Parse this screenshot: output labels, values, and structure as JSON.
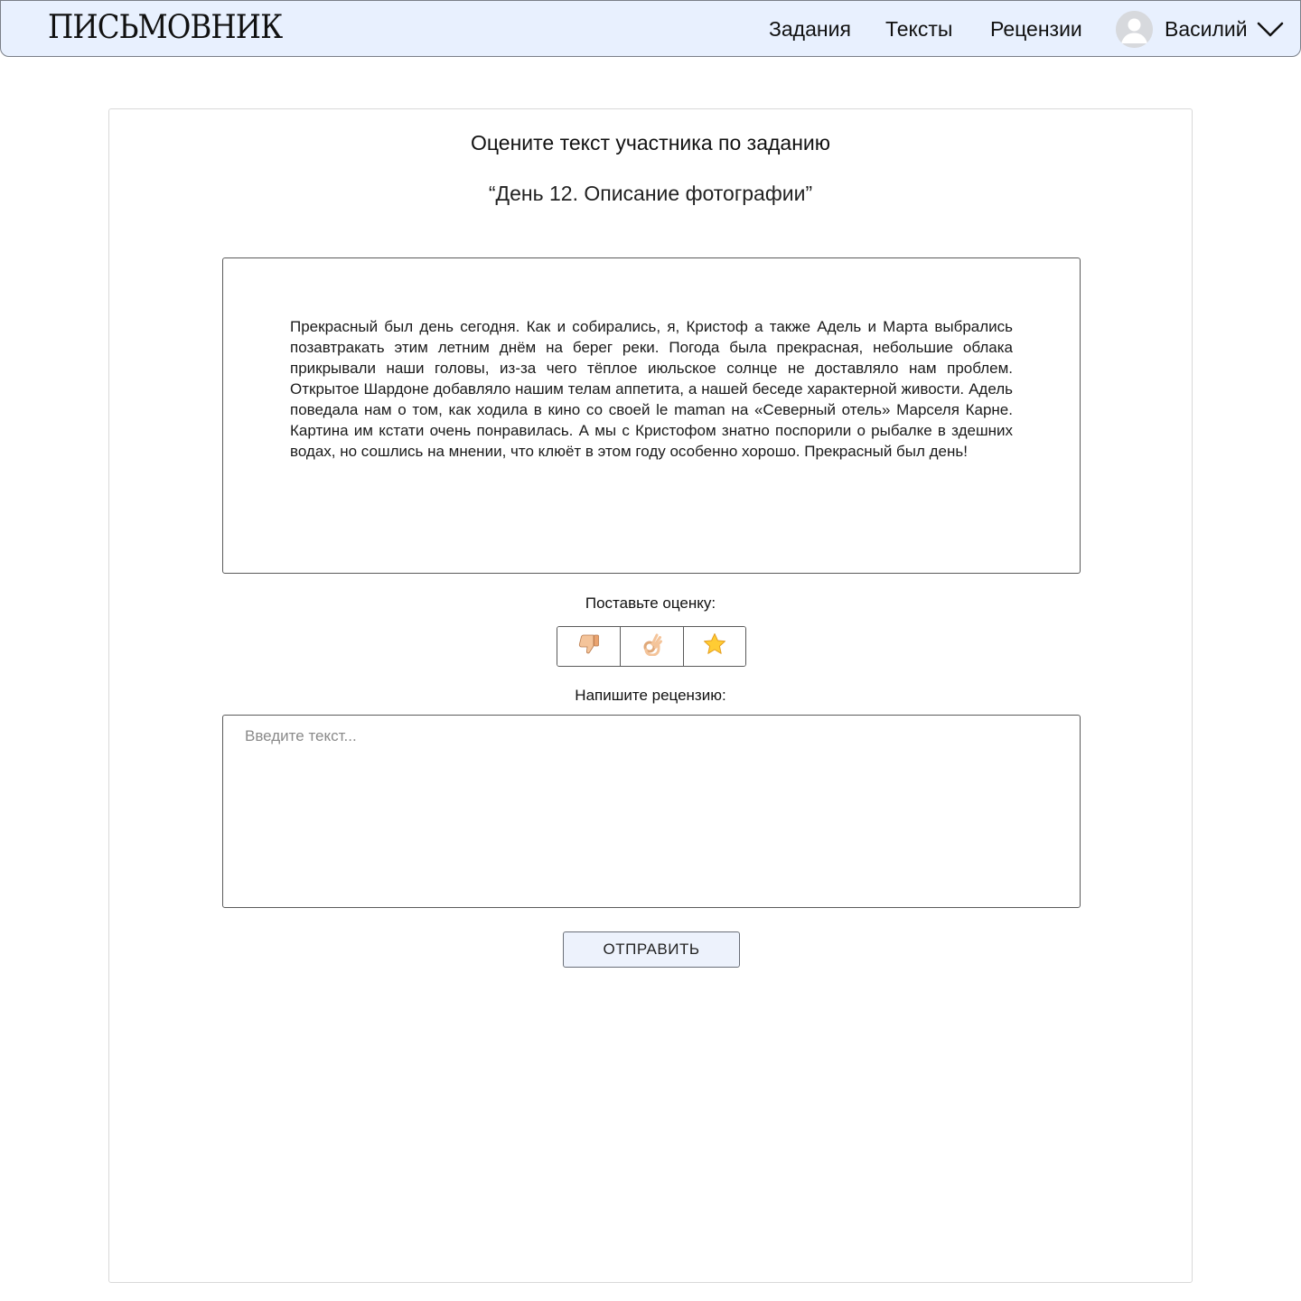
{
  "header": {
    "logo": "ПИСЬМОВНИК",
    "nav": {
      "tasks": "Задания",
      "texts": "Тексты",
      "reviews": "Рецензии"
    },
    "user": {
      "name": "Василий",
      "avatar_icon": "user-avatar-icon",
      "menu_icon": "chevron-down-icon"
    },
    "background": "#e8f0fe"
  },
  "main": {
    "title": "Оцените текст участника по заданию",
    "task_name": "“День 12. Описание фотографии”",
    "submission_text": "Прекрасный был день сегодня. Как и собирались, я, Кристоф а также Адель и Марта выбрались позавтракать этим летним днём на берег реки. Погода была прекрасная, небольшие облака прикрывали наши головы, из-за чего тёплое июльское солнце не доставляло нам проблем. Открытое Шардоне добавляло нашим телам аппетита, а нашей беседе характерной живости. Адель поведала нам о том, как ходила в кино со своей le maman на «Северный отель» Марселя Карне. Картина им кстати очень понравилась. А мы с Кристофом знатно поспорили о рыбалке в здешних водах, но сошлись на мнении, что клюёт в этом году особенно хорошо. Прекрасный был день!",
    "rating": {
      "label": "Поставьте оценку:",
      "options": [
        "thumbs-down-icon",
        "ok-hand-icon",
        "star-icon"
      ]
    },
    "review": {
      "label": "Напишите рецензию:",
      "placeholder": "Введите текст...",
      "value": ""
    },
    "submit_label": "ОТПРАВИТЬ",
    "submit_background": "#edf2fc"
  }
}
